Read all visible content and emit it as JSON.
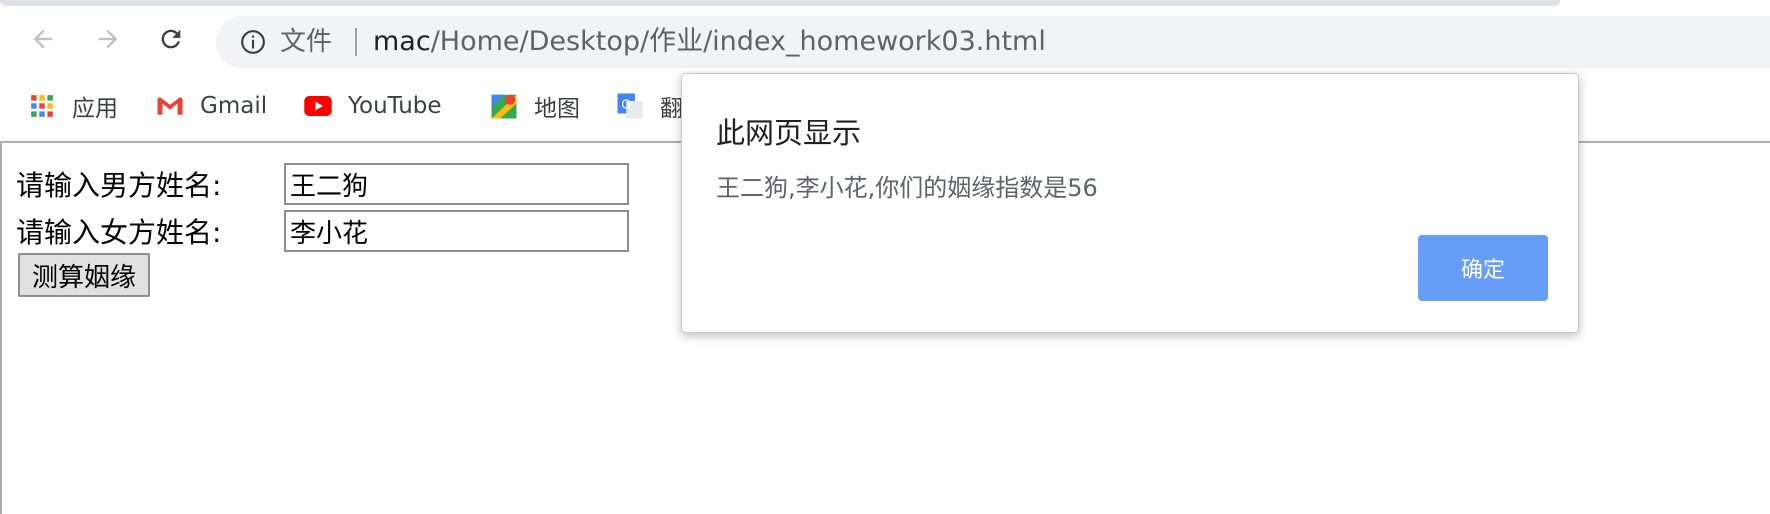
{
  "browser": {
    "origin_label": "文件",
    "url_host": "mac",
    "url_path": "/Home/Desktop/作业/index_homework03.html",
    "bookmarks": [
      {
        "label": "应用",
        "icon": "apps-grid-icon"
      },
      {
        "label": "Gmail",
        "icon": "gmail-icon"
      },
      {
        "label": "YouTube",
        "icon": "youtube-icon"
      },
      {
        "label": "地图",
        "icon": "maps-icon"
      },
      {
        "label": "翻",
        "icon": "translate-icon"
      }
    ]
  },
  "form": {
    "male_label": "请输入男方姓名:",
    "male_value": "王二狗",
    "female_label": "请输入女方姓名:",
    "female_value": "李小花",
    "submit_label": "测算姻缘"
  },
  "dialog": {
    "title": "此网页显示",
    "message": "王二狗,李小花,你们的姻缘指数是56",
    "ok_label": "确定"
  },
  "colors": {
    "dialog_ok_bg": "#669df6",
    "omnibox_bg": "#f1f3f4"
  }
}
